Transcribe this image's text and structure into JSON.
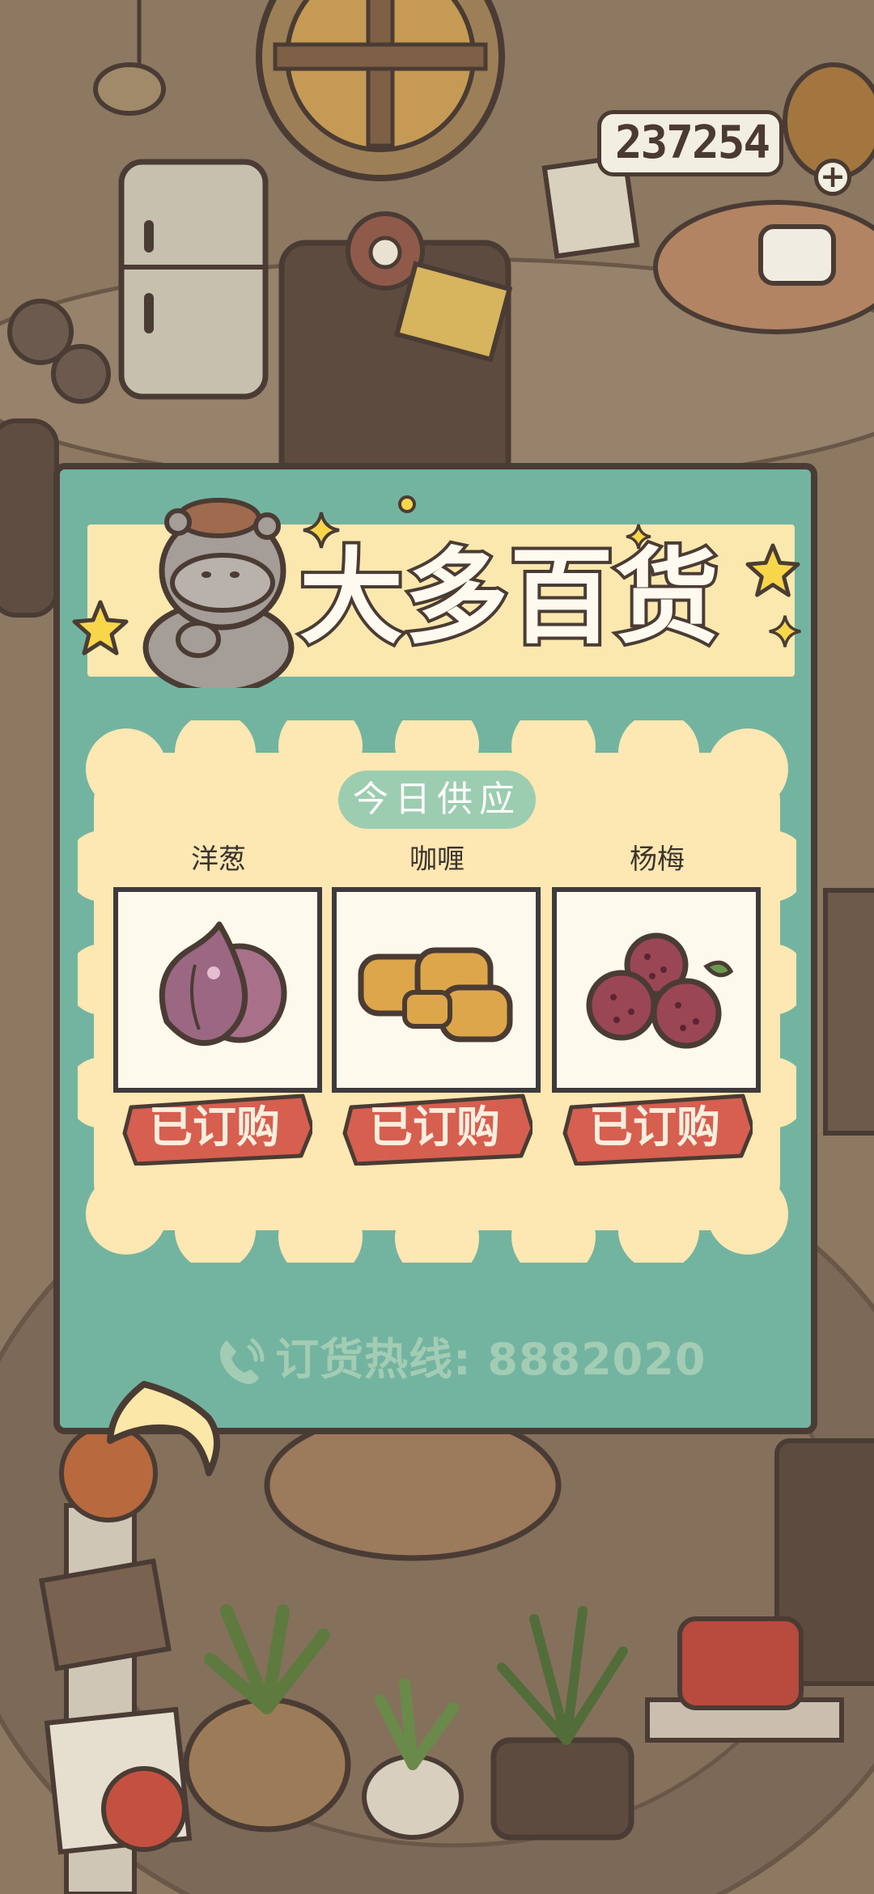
{
  "currency": {
    "amount": "237254",
    "add_label": "+"
  },
  "shop": {
    "title": "大多百货",
    "section_label": "今日供应",
    "items": [
      {
        "name": "洋葱",
        "status": "已订购"
      },
      {
        "name": "咖喱",
        "status": "已订购"
      },
      {
        "name": "杨梅",
        "status": "已订购"
      }
    ],
    "hotline": "订货热线: 8882020"
  },
  "icons": {
    "back": "back-arrow-icon",
    "phone": "phone-icon",
    "mascot": "hippo-mascot-icon"
  },
  "colors": {
    "panel": "#73b4a1",
    "banner": "#fbe8ae",
    "stamp": "#d65f50",
    "outline": "#4a3c34"
  }
}
